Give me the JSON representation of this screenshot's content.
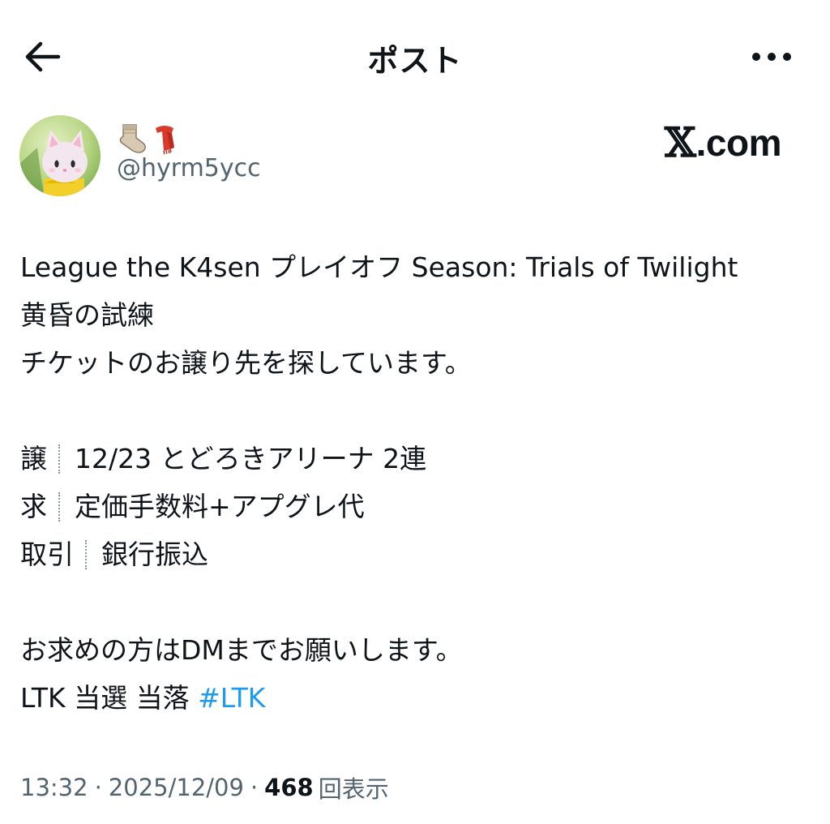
{
  "header": {
    "title": "ポスト",
    "back_icon": "arrow-left-icon",
    "more_icon": "more-horizontal-icon"
  },
  "author": {
    "emoji": [
      "🧦",
      "🧣"
    ],
    "handle": "@hyrm5ycc",
    "logo": {
      "x": "𝕏",
      "text": ".com"
    }
  },
  "post": {
    "line1": "League the K4sen プレイオフ Season: Trials of Twilight",
    "line2": "黄昏の試練",
    "line3": "チケットのお譲り先を探しています。",
    "details": [
      {
        "key": "譲",
        "value": "12/23 とどろきアリーナ 2連"
      },
      {
        "key": "求",
        "value": "定価手数料+アプグレ代"
      },
      {
        "key": "取引",
        "value": "銀行振込"
      }
    ],
    "line4": "お求めの方はDMまでお願いします。",
    "tags_plain": "LTK 当選 当落 ",
    "hashtag": "#LTK"
  },
  "meta": {
    "time": "13:32",
    "separator": "·",
    "date": "2025/12/09",
    "views": "468",
    "views_label": "回表示"
  },
  "colors": {
    "text": "#0f1419",
    "secondary": "#536471",
    "link": "#1d9bf0"
  }
}
